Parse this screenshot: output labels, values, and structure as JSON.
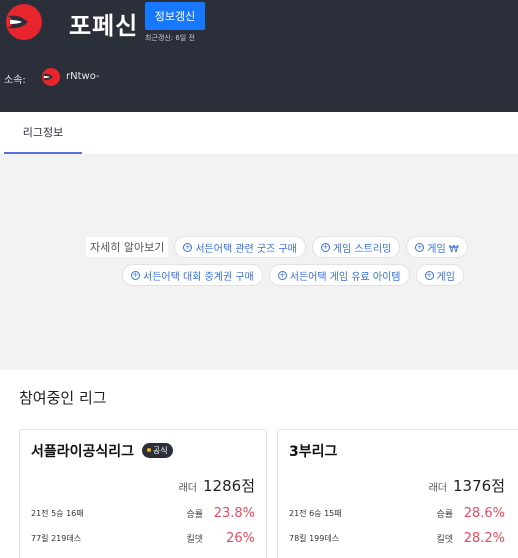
{
  "header": {
    "title": "포페신",
    "update_button": "정보갱신",
    "last_updated": "최근갱신: 6일 전",
    "affiliation_label": "소속:",
    "affiliation_name": "rNtwo-",
    "logo_icon": "team-logo-icon",
    "colors": {
      "background": "#2b2f3a",
      "accent": "#1677ff",
      "logo": "#e8242d"
    }
  },
  "tabs": [
    {
      "label": "리그정보",
      "active": true
    }
  ],
  "links": {
    "learn_more": "자세히 알아보기",
    "row1": [
      "서든어택 관련 굿즈 구매",
      "게임 스트리밍",
      "게임 ₩"
    ],
    "row2": [
      "서든어택 대회 중계권 구매",
      "서든어택 게임 유료 아이템",
      "게임"
    ]
  },
  "leagues": {
    "section_title": "참여중인 리그",
    "cards": [
      {
        "name": "서플라이공식리그",
        "badge": "공식",
        "ladder_label": "래더",
        "ladder_value": "1286점",
        "record": "21전 5승 16패",
        "winrate_label": "승률",
        "winrate": "23.8%",
        "kd": "77킬 219데스",
        "kd_label": "킬뎃",
        "kd_value": "26%"
      },
      {
        "name": "3부리그",
        "ladder_label": "래더",
        "ladder_value": "1376점",
        "record": "21전 6승 15패",
        "winrate_label": "승률",
        "winrate": "28.6%",
        "kd": "78킬 199데스",
        "kd_label": "킬뎃",
        "kd_value": "28.2%"
      }
    ]
  }
}
